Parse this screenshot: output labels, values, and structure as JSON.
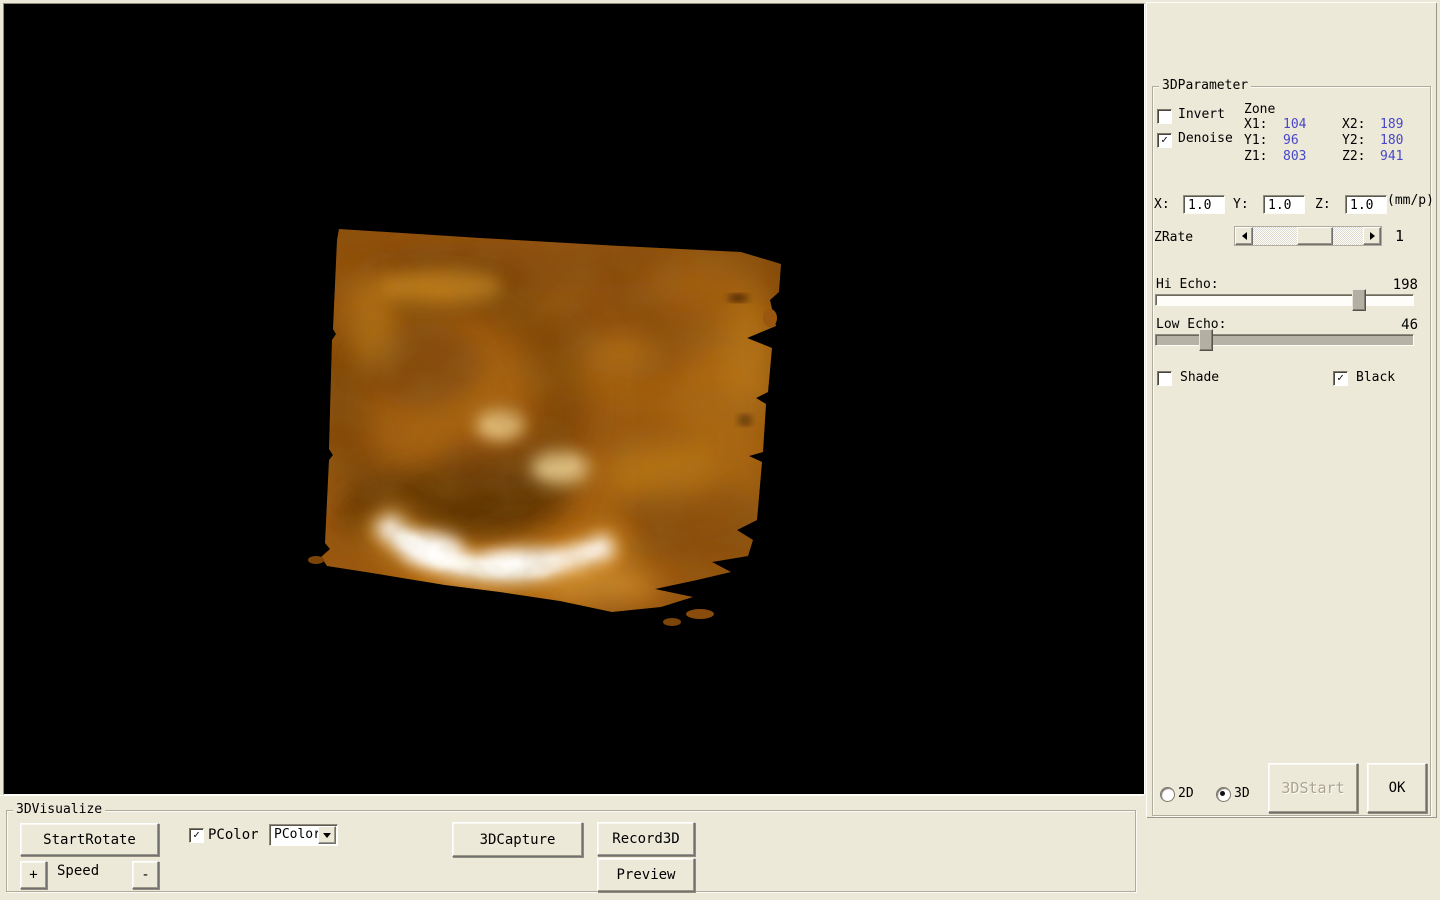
{
  "colors": {
    "window_bg": "#ece9d8",
    "viewport_bg": "#000000",
    "zone_value_blue": "#4747cb",
    "volume_amber_mid": "#a25c10",
    "volume_amber_dark": "#5e3305",
    "volume_highlight": "#ffffff"
  },
  "viewport": {
    "description": "3D ultrasound volume render (fetal face, amber palette)"
  },
  "right_panel": {
    "group_title": "3DParameter",
    "invert_label": "Invert",
    "denoise_label": "Denoise",
    "zone": {
      "title": "Zone",
      "x1_label": "X1:",
      "x1": "104",
      "x2_label": "X2:",
      "x2": "189",
      "y1_label": "Y1:",
      "y1": "96",
      "y2_label": "Y2:",
      "y2": "180",
      "z1_label": "Z1:",
      "z1": "803",
      "z2_label": "Z2:",
      "z2": "941"
    },
    "scale": {
      "x_label": "X:",
      "x_value": "1.0",
      "y_label": "Y:",
      "y_value": "1.0",
      "z_label": "Z:",
      "z_value": "1.0",
      "unit": "(mm/p)"
    },
    "zrate": {
      "label": "ZRate",
      "value": "1"
    },
    "hi_echo": {
      "label": "Hi Echo:",
      "value": "198"
    },
    "low_echo": {
      "label": "Low Echo:",
      "value": "46"
    },
    "shade_label": "Shade",
    "black_label": "Black",
    "mode_2d_label": "2D",
    "mode_3d_label": "3D",
    "start_button": "3DStart",
    "ok_button": "OK"
  },
  "bottom_panel": {
    "group_title": "3DVisualize",
    "start_rotate_button": "StartRotate",
    "pcolor_check_label": "PColor",
    "pcolor_combo_value": "PColor",
    "capture_button": "3DCapture",
    "record_button": "Record3D",
    "preview_button": "Preview",
    "speed_plus": "+",
    "speed_label": "Speed",
    "speed_minus": "-"
  },
  "icons": {
    "check": "✓",
    "scroll_left": "left-triangle",
    "scroll_right": "right-triangle",
    "dropdown": "down-triangle"
  }
}
